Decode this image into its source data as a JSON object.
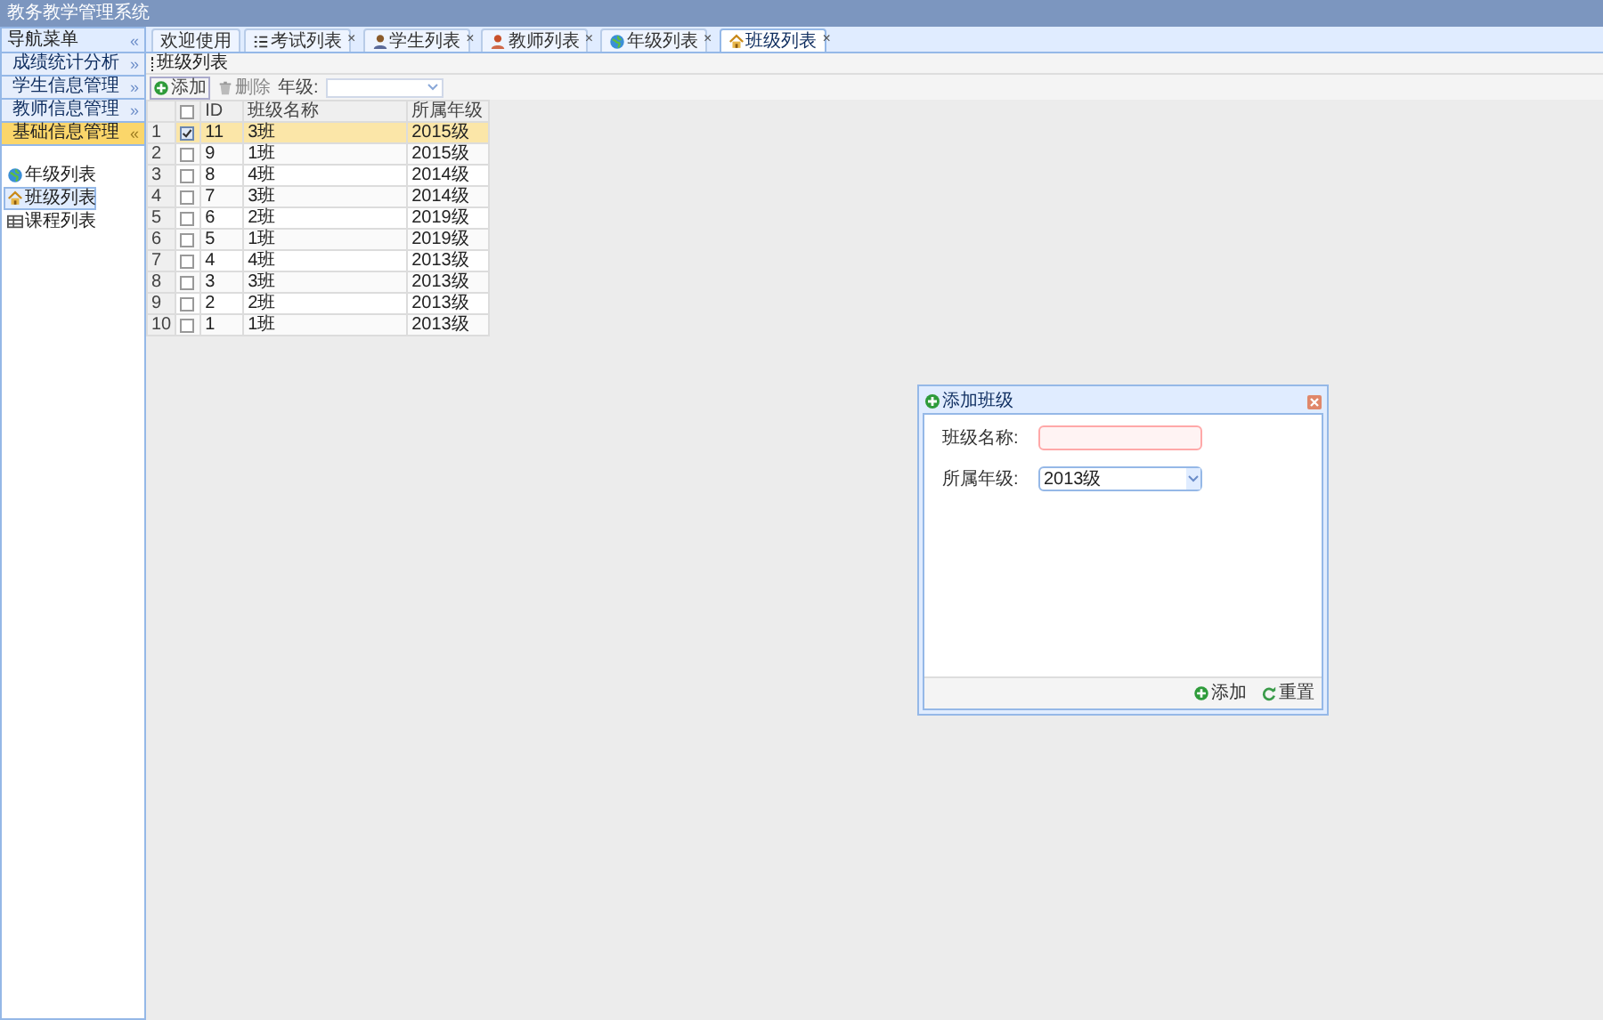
{
  "window": {
    "title": "教务教学管理系统"
  },
  "sidebar": {
    "title": "导航菜单",
    "collapse_glyph": "«",
    "sections": [
      {
        "label": "成绩统计分析",
        "expanded": false,
        "glyph": "»"
      },
      {
        "label": "学生信息管理",
        "expanded": false,
        "glyph": "»"
      },
      {
        "label": "教师信息管理",
        "expanded": false,
        "glyph": "»"
      },
      {
        "label": "基础信息管理",
        "expanded": true,
        "glyph": "«",
        "items": [
          {
            "label": "年级列表",
            "selected": false
          },
          {
            "label": "班级列表",
            "selected": true
          },
          {
            "label": "课程列表",
            "selected": false
          }
        ]
      }
    ]
  },
  "tabs": [
    {
      "label": "欢迎使用",
      "closable": false,
      "selected": false
    },
    {
      "label": "考试列表",
      "closable": true,
      "selected": false
    },
    {
      "label": "学生列表",
      "closable": true,
      "selected": false
    },
    {
      "label": "教师列表",
      "closable": true,
      "selected": false
    },
    {
      "label": "年级列表",
      "closable": true,
      "selected": false
    },
    {
      "label": "班级列表",
      "closable": true,
      "selected": true
    }
  ],
  "close_glyph": "×",
  "panel": {
    "title": "班级列表",
    "toolbar": {
      "add": "添加",
      "delete": "删除",
      "grade_label": "年级:"
    }
  },
  "table": {
    "all_checked": false,
    "columns": [
      "ID",
      "班级名称",
      "所属年级"
    ],
    "rows": [
      {
        "num": "1",
        "id": "11",
        "name": "3班",
        "grade": "2015级",
        "checked": true,
        "selected": true
      },
      {
        "num": "2",
        "id": "9",
        "name": "1班",
        "grade": "2015级",
        "checked": false,
        "selected": false
      },
      {
        "num": "3",
        "id": "8",
        "name": "4班",
        "grade": "2014级",
        "checked": false,
        "selected": false
      },
      {
        "num": "4",
        "id": "7",
        "name": "3班",
        "grade": "2014级",
        "checked": false,
        "selected": false
      },
      {
        "num": "5",
        "id": "6",
        "name": "2班",
        "grade": "2019级",
        "checked": false,
        "selected": false
      },
      {
        "num": "6",
        "id": "5",
        "name": "1班",
        "grade": "2019级",
        "checked": false,
        "selected": false
      },
      {
        "num": "7",
        "id": "4",
        "name": "4班",
        "grade": "2013级",
        "checked": false,
        "selected": false
      },
      {
        "num": "8",
        "id": "3",
        "name": "3班",
        "grade": "2013级",
        "checked": false,
        "selected": false
      },
      {
        "num": "9",
        "id": "2",
        "name": "2班",
        "grade": "2013级",
        "checked": false,
        "selected": false
      },
      {
        "num": "10",
        "id": "1",
        "name": "1班",
        "grade": "2013级",
        "checked": false,
        "selected": false
      }
    ]
  },
  "dialog": {
    "title": "添加班级",
    "fields": [
      {
        "kind": "text",
        "label": "班级名称:",
        "invalid": true
      },
      {
        "kind": "select",
        "label": "所属年级:",
        "value": "2013级"
      }
    ],
    "buttons": [
      {
        "label": "添加"
      },
      {
        "label": "重置"
      }
    ]
  }
}
